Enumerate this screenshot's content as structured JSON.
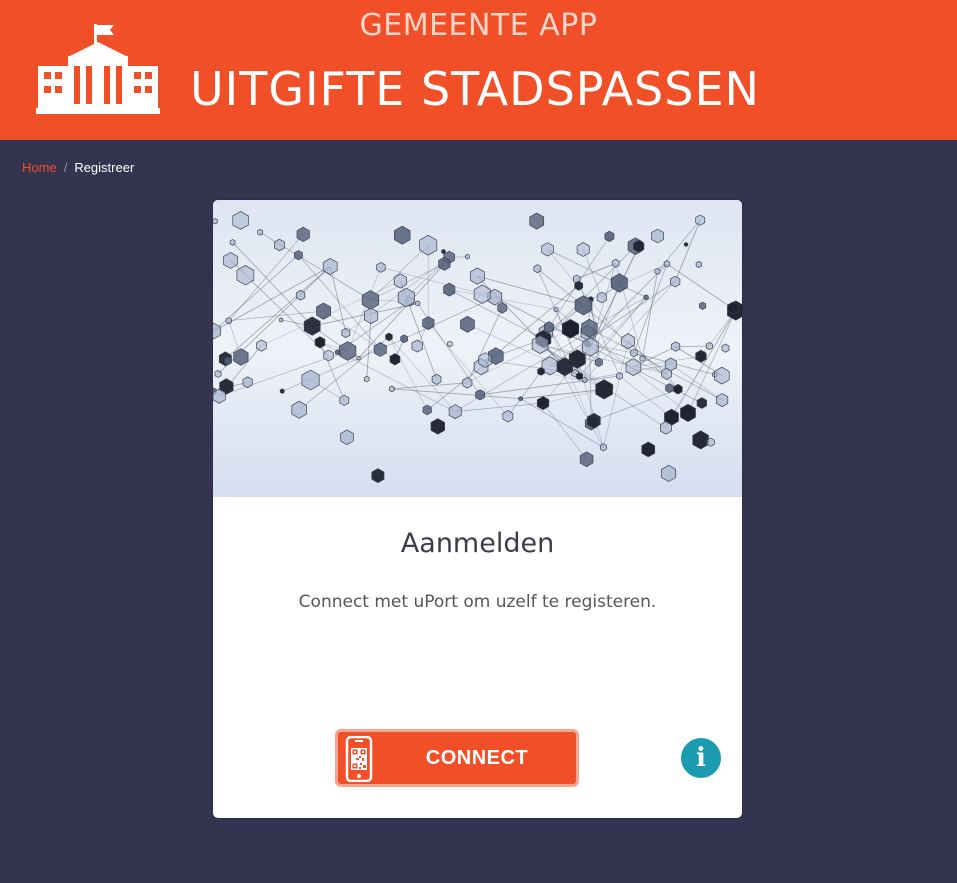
{
  "header": {
    "app_name": "GEMEENTE APP",
    "title": "UITGIFTE STADSPASSEN",
    "logo_icon": "town-hall-icon",
    "background_color": "#f04f28"
  },
  "breadcrumb": {
    "home_label": "Home",
    "separator": "/",
    "current_label": "Registreer"
  },
  "card": {
    "image": "network-graph-image",
    "title": "Aanmelden",
    "text": "Connect met uPort om uzelf te registeren.",
    "connect_button": {
      "label": "CONNECT",
      "icon": "phone-qr-icon",
      "color": "#f04f28"
    },
    "info_button": {
      "icon": "info-icon",
      "glyph": "i",
      "color": "#1a9bb0"
    }
  },
  "colors": {
    "page_background": "#343450",
    "accent": "#f04f28"
  }
}
